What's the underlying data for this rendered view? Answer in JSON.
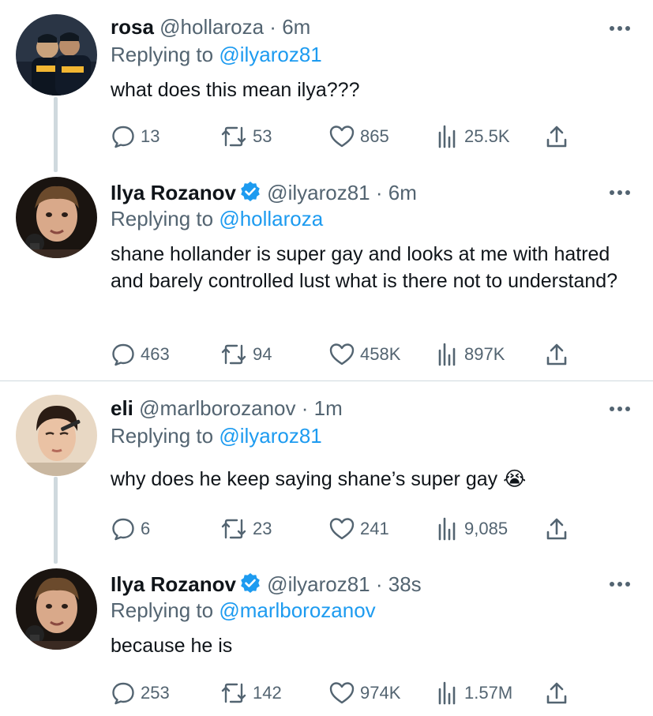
{
  "tweets": [
    {
      "name": "rosa",
      "handle": "@hollaroza",
      "dot": "·",
      "time": "6m",
      "verified": false,
      "replying_label": "Replying to",
      "replying_to": "@ilyaroz81",
      "text": "what does this mean ilya???",
      "replies": "13",
      "retweets": "53",
      "likes": "865",
      "views": "25.5K"
    },
    {
      "name": "Ilya Rozanov",
      "handle": "@ilyaroz81",
      "dot": "·",
      "time": "6m",
      "verified": true,
      "replying_label": "Replying to",
      "replying_to": "@hollaroza",
      "text": "shane hollander is super gay and looks at me with hatred and barely controlled lust what is there not to understand?",
      "replies": "463",
      "retweets": "94",
      "likes": "458K",
      "views": "897K"
    },
    {
      "name": "eli",
      "handle": "@marlborozanov",
      "dot": "·",
      "time": "1m",
      "verified": false,
      "replying_label": "Replying to",
      "replying_to": "@ilyaroz81",
      "text": "why does he keep saying shane’s super gay",
      "emoji": "😭",
      "replies": "6",
      "retweets": "23",
      "likes": "241",
      "views": "9,085"
    },
    {
      "name": "Ilya Rozanov",
      "handle": "@ilyaroz81",
      "dot": "·",
      "time": "38s",
      "verified": true,
      "replying_label": "Replying to",
      "replying_to": "@marlborozanov",
      "text": "because he is",
      "replies": "253",
      "retweets": "142",
      "likes": "974K",
      "views": "1.57M"
    }
  ],
  "colors": {
    "accent": "#1d9bf0",
    "secondary_text": "#536471",
    "primary_text": "#0f1419",
    "thread_line": "#cfd9de"
  },
  "icons": {
    "reply": "reply-bubble-icon",
    "retweet": "retweet-icon",
    "like": "heart-icon",
    "views": "views-bar-chart-icon",
    "share": "share-upload-icon",
    "more": "more-dots-icon",
    "verified": "verified-badge-icon"
  }
}
